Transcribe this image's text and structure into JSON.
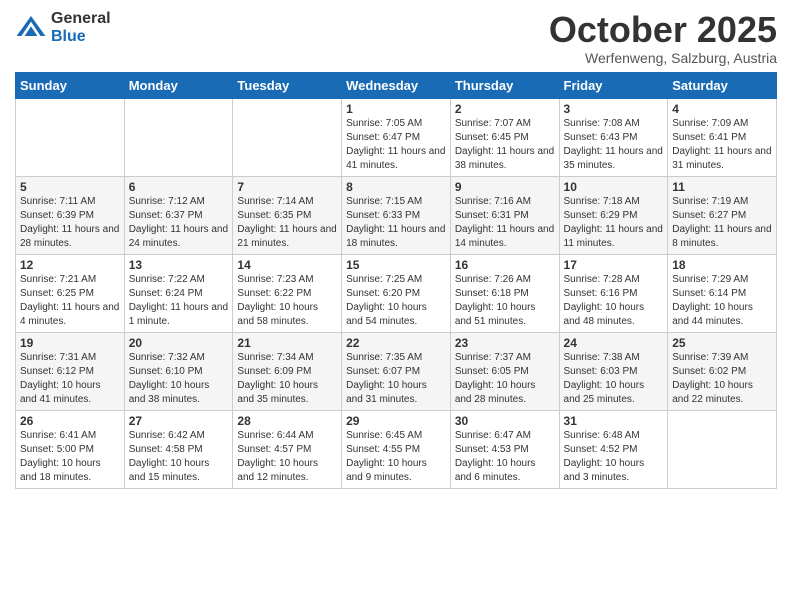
{
  "header": {
    "logo_general": "General",
    "logo_blue": "Blue",
    "title": "October 2025",
    "location": "Werfenweng, Salzburg, Austria"
  },
  "days_of_week": [
    "Sunday",
    "Monday",
    "Tuesday",
    "Wednesday",
    "Thursday",
    "Friday",
    "Saturday"
  ],
  "weeks": [
    [
      {
        "day": "",
        "info": ""
      },
      {
        "day": "",
        "info": ""
      },
      {
        "day": "",
        "info": ""
      },
      {
        "day": "1",
        "info": "Sunrise: 7:05 AM\nSunset: 6:47 PM\nDaylight: 11 hours and 41 minutes."
      },
      {
        "day": "2",
        "info": "Sunrise: 7:07 AM\nSunset: 6:45 PM\nDaylight: 11 hours and 38 minutes."
      },
      {
        "day": "3",
        "info": "Sunrise: 7:08 AM\nSunset: 6:43 PM\nDaylight: 11 hours and 35 minutes."
      },
      {
        "day": "4",
        "info": "Sunrise: 7:09 AM\nSunset: 6:41 PM\nDaylight: 11 hours and 31 minutes."
      }
    ],
    [
      {
        "day": "5",
        "info": "Sunrise: 7:11 AM\nSunset: 6:39 PM\nDaylight: 11 hours and 28 minutes."
      },
      {
        "day": "6",
        "info": "Sunrise: 7:12 AM\nSunset: 6:37 PM\nDaylight: 11 hours and 24 minutes."
      },
      {
        "day": "7",
        "info": "Sunrise: 7:14 AM\nSunset: 6:35 PM\nDaylight: 11 hours and 21 minutes."
      },
      {
        "day": "8",
        "info": "Sunrise: 7:15 AM\nSunset: 6:33 PM\nDaylight: 11 hours and 18 minutes."
      },
      {
        "day": "9",
        "info": "Sunrise: 7:16 AM\nSunset: 6:31 PM\nDaylight: 11 hours and 14 minutes."
      },
      {
        "day": "10",
        "info": "Sunrise: 7:18 AM\nSunset: 6:29 PM\nDaylight: 11 hours and 11 minutes."
      },
      {
        "day": "11",
        "info": "Sunrise: 7:19 AM\nSunset: 6:27 PM\nDaylight: 11 hours and 8 minutes."
      }
    ],
    [
      {
        "day": "12",
        "info": "Sunrise: 7:21 AM\nSunset: 6:25 PM\nDaylight: 11 hours and 4 minutes."
      },
      {
        "day": "13",
        "info": "Sunrise: 7:22 AM\nSunset: 6:24 PM\nDaylight: 11 hours and 1 minute."
      },
      {
        "day": "14",
        "info": "Sunrise: 7:23 AM\nSunset: 6:22 PM\nDaylight: 10 hours and 58 minutes."
      },
      {
        "day": "15",
        "info": "Sunrise: 7:25 AM\nSunset: 6:20 PM\nDaylight: 10 hours and 54 minutes."
      },
      {
        "day": "16",
        "info": "Sunrise: 7:26 AM\nSunset: 6:18 PM\nDaylight: 10 hours and 51 minutes."
      },
      {
        "day": "17",
        "info": "Sunrise: 7:28 AM\nSunset: 6:16 PM\nDaylight: 10 hours and 48 minutes."
      },
      {
        "day": "18",
        "info": "Sunrise: 7:29 AM\nSunset: 6:14 PM\nDaylight: 10 hours and 44 minutes."
      }
    ],
    [
      {
        "day": "19",
        "info": "Sunrise: 7:31 AM\nSunset: 6:12 PM\nDaylight: 10 hours and 41 minutes."
      },
      {
        "day": "20",
        "info": "Sunrise: 7:32 AM\nSunset: 6:10 PM\nDaylight: 10 hours and 38 minutes."
      },
      {
        "day": "21",
        "info": "Sunrise: 7:34 AM\nSunset: 6:09 PM\nDaylight: 10 hours and 35 minutes."
      },
      {
        "day": "22",
        "info": "Sunrise: 7:35 AM\nSunset: 6:07 PM\nDaylight: 10 hours and 31 minutes."
      },
      {
        "day": "23",
        "info": "Sunrise: 7:37 AM\nSunset: 6:05 PM\nDaylight: 10 hours and 28 minutes."
      },
      {
        "day": "24",
        "info": "Sunrise: 7:38 AM\nSunset: 6:03 PM\nDaylight: 10 hours and 25 minutes."
      },
      {
        "day": "25",
        "info": "Sunrise: 7:39 AM\nSunset: 6:02 PM\nDaylight: 10 hours and 22 minutes."
      }
    ],
    [
      {
        "day": "26",
        "info": "Sunrise: 6:41 AM\nSunset: 5:00 PM\nDaylight: 10 hours and 18 minutes."
      },
      {
        "day": "27",
        "info": "Sunrise: 6:42 AM\nSunset: 4:58 PM\nDaylight: 10 hours and 15 minutes."
      },
      {
        "day": "28",
        "info": "Sunrise: 6:44 AM\nSunset: 4:57 PM\nDaylight: 10 hours and 12 minutes."
      },
      {
        "day": "29",
        "info": "Sunrise: 6:45 AM\nSunset: 4:55 PM\nDaylight: 10 hours and 9 minutes."
      },
      {
        "day": "30",
        "info": "Sunrise: 6:47 AM\nSunset: 4:53 PM\nDaylight: 10 hours and 6 minutes."
      },
      {
        "day": "31",
        "info": "Sunrise: 6:48 AM\nSunset: 4:52 PM\nDaylight: 10 hours and 3 minutes."
      },
      {
        "day": "",
        "info": ""
      }
    ]
  ]
}
